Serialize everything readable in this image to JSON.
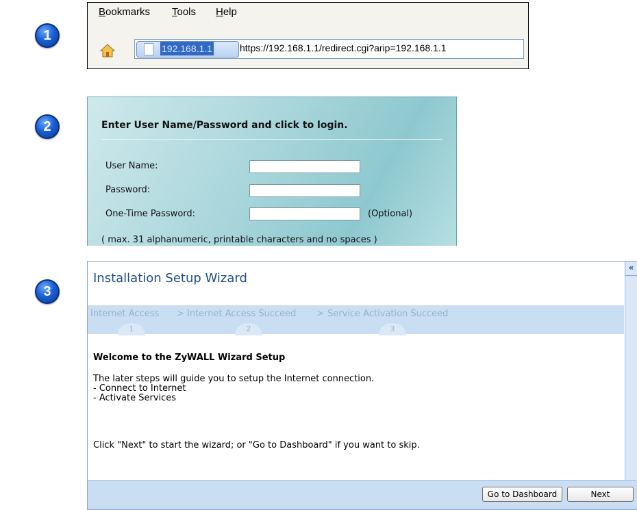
{
  "badges": [
    "1",
    "2",
    "3"
  ],
  "browser": {
    "menu": [
      "Bookmarks",
      "Tools",
      "Help"
    ],
    "url_host": "192.168.1.1",
    "url": "https://192.168.1.1/redirect.cgi?arip=192.168.1.1"
  },
  "login": {
    "title": "Enter User Name/Password and click to login.",
    "user_label": "User Name:",
    "password_label": "Password:",
    "otp_label": "One-Time Password:",
    "optional": "(Optional)",
    "hint": "( max. 31 alphanumeric, printable characters and no spaces )"
  },
  "wizard": {
    "title": "Installation Setup Wizard",
    "collapse": "«",
    "steps": [
      {
        "label": "Internet Access",
        "num": "1"
      },
      {
        "label": "Internet Access Succeed",
        "num": "2"
      },
      {
        "label": "Service Activation Succeed",
        "num": "3"
      }
    ],
    "separator": ">",
    "heading": "Welcome to the ZyWALL Wizard Setup",
    "intro": "The later steps will guide you to setup the Internet connection.",
    "bullet1": "- Connect to Internet",
    "bullet2": "- Activate Services",
    "instruction": "Click \"Next\" to start the wizard; or \"Go to Dashboard\" if you want to skip.",
    "dashboard_button": "Go to Dashboard",
    "next_button": "Next"
  },
  "colors": {
    "badge": "#1a5fd6",
    "wizard_title": "#1f4f86",
    "wizard_band": "#c9ddf3",
    "url_highlight": "#316ac5"
  }
}
